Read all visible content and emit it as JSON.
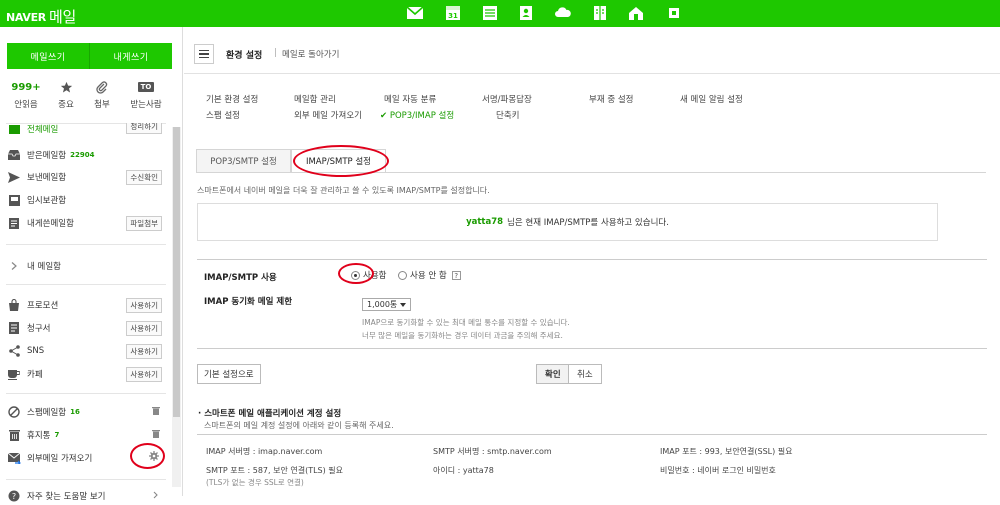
{
  "topbar": {
    "logo_brand": "NAVER",
    "logo_service": "메일",
    "calendar_day": "31",
    "bg_color": "#1ec800"
  },
  "sidebar": {
    "compose_label": "메일쓰기",
    "self_compose_label": "내게쓰기",
    "quick": {
      "unread_count": "999+",
      "unread_label": "안읽음",
      "important_label": "중요",
      "attach_label": "첨부",
      "to_badge": "TO",
      "sender_label": "받는사람"
    },
    "folders": {
      "all": {
        "name": "전체메일",
        "btn": "정리하기"
      },
      "inbox": {
        "name": "받은메일함",
        "count": "22904"
      },
      "sent": {
        "name": "보낸메일함",
        "btn": "수신확인"
      },
      "drafts": {
        "name": "임시보관함"
      },
      "self": {
        "name": "내게쓴메일함",
        "btn": "파일첨부"
      },
      "my": {
        "name": "내 메일함"
      },
      "promo": {
        "name": "프로모션",
        "btn": "사용하기"
      },
      "bill": {
        "name": "청구서",
        "btn": "사용하기"
      },
      "sns": {
        "name": "SNS",
        "btn": "사용하기"
      },
      "cafe": {
        "name": "카페",
        "btn": "사용하기"
      },
      "spam": {
        "name": "스팸메일함",
        "count": "16"
      },
      "trash": {
        "name": "휴지통",
        "count": "7"
      },
      "external": {
        "name": "외부메일 가져오기"
      },
      "help": {
        "name": "자주 찾는 도움말 보기"
      }
    }
  },
  "main": {
    "title": "환경 설정",
    "back": "메일로 돌아가기",
    "settings_links": {
      "basic": "기본 환경 설정",
      "folder": "메일함 관리",
      "filter": "메일 자동 분류",
      "signature": "서명/파몽답장",
      "absence": "부재 중 설정",
      "notify": "새 메일 알림 설정",
      "spam": "스팸 설정",
      "external": "외부 메일 가져오기",
      "pop3": "✔ POP3/IMAP 설정",
      "shortcut": "단축키"
    },
    "tabs": {
      "pop3": "POP3/SMTP 설정",
      "imap": "IMAP/SMTP 설정"
    },
    "description": "스마트폰에서 네이버 메일을 더욱 잘 관리하고 쓸 수 있도록 IMAP/SMTP를 설정합니다.",
    "status": {
      "user": "yatta78",
      "text": "님은 현재 IMAP/SMTP를 사용하고 있습니다."
    },
    "form": {
      "imap_label": "IMAP/SMTP 사용",
      "use": "사용함",
      "not_use": "사용 안 함",
      "help": "?",
      "sync_label": "IMAP 동기화 메일 제한",
      "sync_value": "1,000통",
      "hint1": "IMAP으로 동기화할 수 있는 최대 메일 통수를 지정할 수 있습니다.",
      "hint2": "너무 많은 메일을 동기화하는 경우 데이터 과금을 주의해 주세요."
    },
    "buttons": {
      "default": "기본 설정으로",
      "ok": "확인",
      "cancel": "취소"
    },
    "app_section": {
      "title": "스마트폰 메일 애플리케이션 계정 설정",
      "desc": "스마트폰의 메일 계정 설정에 아래와 같이 등록해 주세요.",
      "imap_server": "IMAP 서버명 : imap.naver.com",
      "smtp_server": "SMTP 서버명 : smtp.naver.com",
      "imap_port": "IMAP 포트 : 993, 보안연결(SSL) 필요",
      "smtp_port": "SMTP 포트 : 587, 보안 연결(TLS) 필요",
      "smtp_port_note": "(TLS가 없는 경우 SSL로 연결)",
      "user_id": "아이디 : yatta78",
      "password": "비밀번호 : 네이버 로그인 비밀번호"
    }
  }
}
